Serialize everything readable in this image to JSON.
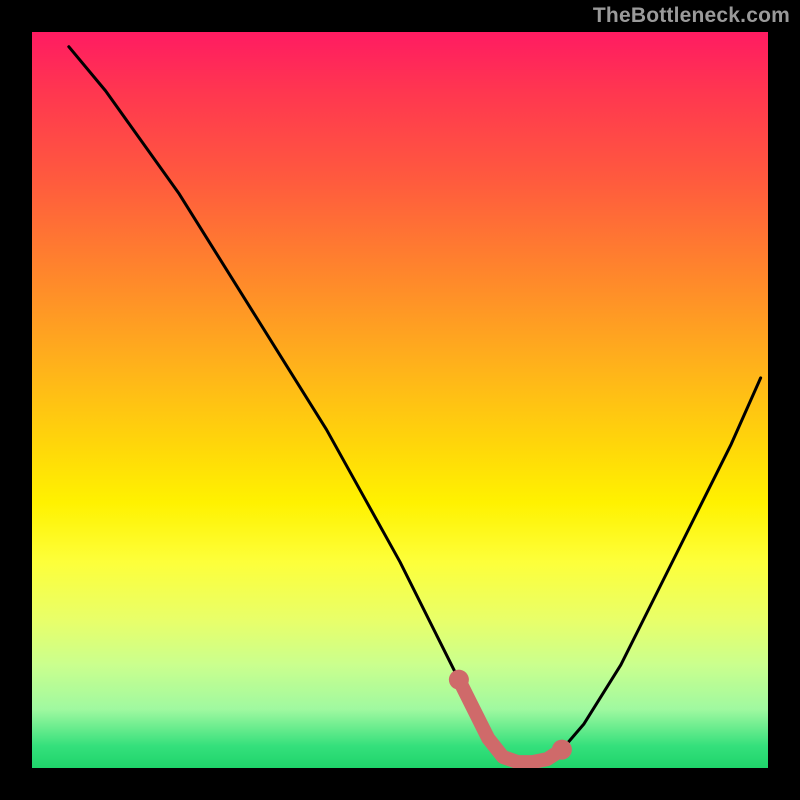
{
  "watermark": "TheBottleneck.com",
  "chart_data": {
    "type": "line",
    "title": "",
    "xlabel": "",
    "ylabel": "",
    "xlim": [
      0,
      100
    ],
    "ylim": [
      0,
      100
    ],
    "grid": false,
    "legend": false,
    "series": [
      {
        "name": "curve",
        "color": "#000000",
        "x": [
          5,
          10,
          15,
          20,
          25,
          30,
          35,
          40,
          45,
          50,
          55,
          58,
          60,
          62,
          64,
          66,
          68,
          70,
          72,
          75,
          80,
          85,
          90,
          95,
          99
        ],
        "y": [
          98,
          92,
          85,
          78,
          70,
          62,
          54,
          46,
          37,
          28,
          18,
          12,
          8,
          4,
          1.5,
          0.8,
          0.8,
          1.2,
          2.5,
          6,
          14,
          24,
          34,
          44,
          53
        ]
      },
      {
        "name": "highlight",
        "color": "#cf6a6a",
        "x": [
          58,
          60,
          62,
          64,
          66,
          68,
          70,
          72
        ],
        "y": [
          12,
          8,
          4,
          1.5,
          0.8,
          0.8,
          1.2,
          2.5
        ]
      }
    ],
    "highlight_endpoints": [
      {
        "x": 58,
        "y": 12
      },
      {
        "x": 72,
        "y": 2.5
      }
    ]
  }
}
